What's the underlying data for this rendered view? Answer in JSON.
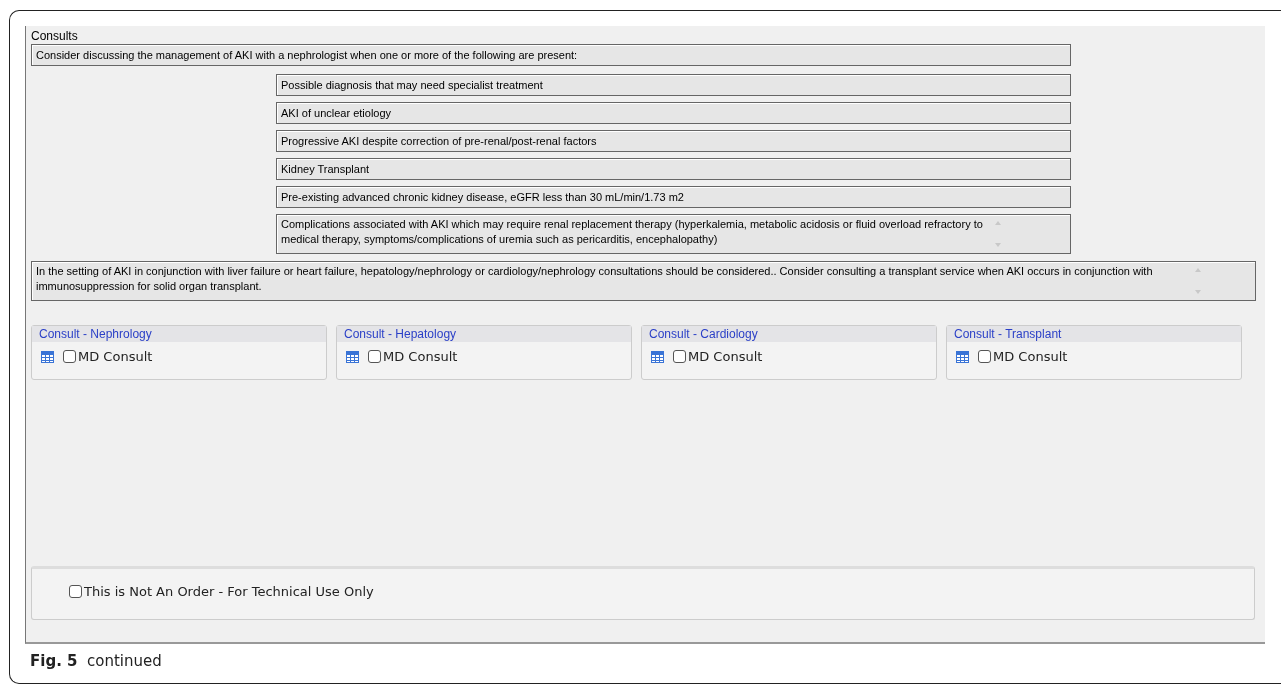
{
  "section_title": "Consults",
  "intro": "Consider discussing the management of AKI with a nephrologist when one or more of the following are present:",
  "criteria": [
    "Possible diagnosis that may need specialist treatment",
    "AKI of unclear etiology",
    "Progressive AKI despite correction of pre-renal/post-renal factors",
    "Kidney Transplant",
    "Pre-existing advanced chronic kidney disease, eGFR less than 30 mL/min/1.73 m2",
    "Complications associated with AKI which may require renal replacement therapy (hyperkalemia, metabolic acidosis or fluid overload refractory to medical therapy, symptoms/complications of uremia such as pericarditis, encephalopathy)"
  ],
  "note": "In the setting of AKI in conjunction with liver failure or heart failure, hepatology/nephrology or cardiology/nephrology consultations should be considered.. Consider consulting a transplant service when AKI occurs in conjunction with immunosuppression for solid organ transplant.",
  "consults": [
    {
      "title": "Consult - Nephrology",
      "option": {
        "label": "MD Consult",
        "checked": false
      }
    },
    {
      "title": "Consult - Hepatology",
      "option": {
        "label": "MD Consult",
        "checked": false
      }
    },
    {
      "title": "Consult - Cardiology",
      "option": {
        "label": "MD Consult",
        "checked": false
      }
    },
    {
      "title": "Consult - Transplant",
      "option": {
        "label": "MD Consult",
        "checked": false
      }
    }
  ],
  "technical_option": {
    "label": "This is Not An Order - For Technical Use Only",
    "checked": false
  },
  "caption": {
    "label": "Fig. 5",
    "text": "continued"
  }
}
